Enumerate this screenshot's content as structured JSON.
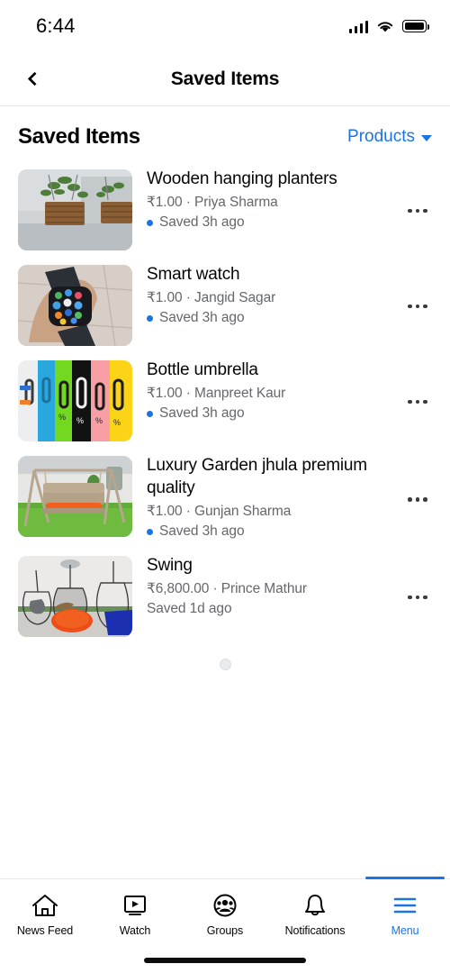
{
  "status_bar": {
    "time": "6:44",
    "signal_icon": "cellular-signal-icon",
    "wifi_icon": "wifi-icon",
    "battery_icon": "battery-full-icon"
  },
  "nav_bar": {
    "back_icon": "chevron-left-icon",
    "title": "Saved Items"
  },
  "section": {
    "title": "Saved Items",
    "filter_label": "Products",
    "filter_caret_icon": "chevron-down-icon",
    "filter_color": "#1b74e4"
  },
  "items": [
    {
      "title": "Wooden hanging planters",
      "meta": "₹1.00 · Priya Sharma",
      "saved": "Saved 3h ago",
      "unread": true,
      "thumb_name": "thumbnail-wooden-hanging-planters"
    },
    {
      "title": "Smart watch",
      "meta": "₹1.00 · Jangid Sagar",
      "saved": "Saved 3h ago",
      "unread": true,
      "thumb_name": "thumbnail-smart-watch"
    },
    {
      "title": "Bottle umbrella",
      "meta": "₹1.00 · Manpreet Kaur",
      "saved": "Saved 3h ago",
      "unread": true,
      "thumb_name": "thumbnail-bottle-umbrella"
    },
    {
      "title": "Luxury Garden jhula premium quality",
      "meta": "₹1.00 · Gunjan Sharma",
      "saved": "Saved 3h ago",
      "unread": true,
      "thumb_name": "thumbnail-luxury-garden-jhula"
    },
    {
      "title": "Swing",
      "meta": "₹6,800.00 · Prince Mathur",
      "saved": "Saved 1d ago",
      "unread": false,
      "thumb_name": "thumbnail-swing"
    }
  ],
  "loader": {
    "icon": "loading-spinner-icon"
  },
  "tab_bar": {
    "active": "Menu",
    "active_color": "#1b74e4",
    "tabs": [
      {
        "label": "News Feed",
        "icon": "home-icon"
      },
      {
        "label": "Watch",
        "icon": "video-play-icon"
      },
      {
        "label": "Groups",
        "icon": "groups-people-icon"
      },
      {
        "label": "Notifications",
        "icon": "bell-icon"
      },
      {
        "label": "Menu",
        "icon": "hamburger-menu-icon"
      }
    ]
  }
}
